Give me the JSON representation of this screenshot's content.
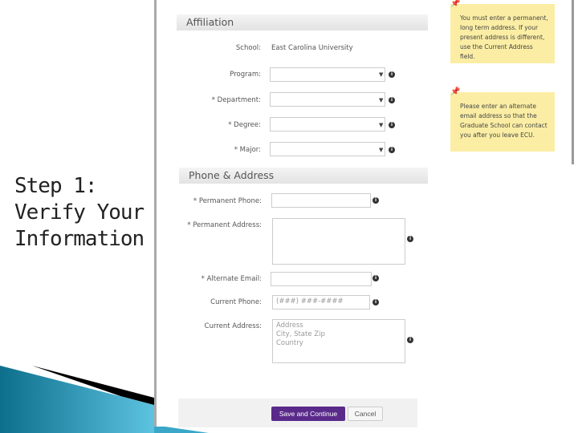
{
  "slide": {
    "title_line1": "Step 1:",
    "title_line2": "Verify Your",
    "title_line3": "Information",
    "accent": "#1a8fb0"
  },
  "affiliation": {
    "heading": "Affiliation",
    "school_label": "School:",
    "school_value": "East Carolina University",
    "program_label": "Program:",
    "department_label": "* Department:",
    "degree_label": "* Degree:",
    "major_label": "* Major:"
  },
  "phone_address": {
    "heading": "Phone & Address",
    "permanent_phone_label": "* Permanent Phone:",
    "permanent_address_label": "* Permanent Address:",
    "alternate_email_label": "* Alternate Email:",
    "current_phone_label": "Current Phone:",
    "current_phone_placeholder": "(###) ###-####",
    "current_address_label": "Current Address:",
    "current_address_placeholder": "Address\nCity, State Zip\nCountry"
  },
  "notes": [
    "You must enter a permanent, long term address. If your present address is different, use the Current Address field.",
    "Please enter an alternate email address so that the Graduate School can contact you after you leave ECU."
  ],
  "buttons": {
    "save": "Save and Continue",
    "cancel": "Cancel",
    "save_color": "#5a2a8a"
  }
}
